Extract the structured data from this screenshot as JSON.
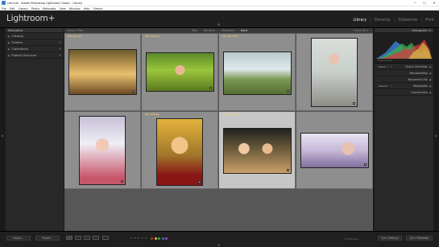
{
  "window": {
    "title": "cat.lrcat - Adobe Photoshop Lightroom Classic - Library",
    "controls": [
      "—",
      "☐",
      "✕"
    ]
  },
  "menu": [
    "File",
    "Edit",
    "Library",
    "Photo",
    "Metadata",
    "View",
    "Window",
    "Help",
    "Simple"
  ],
  "identity": {
    "logo": "Lightroom+",
    "modules": [
      {
        "label": "Library",
        "active": true
      },
      {
        "label": "Develop",
        "active": false
      },
      {
        "label": "Slideshow",
        "active": false
      },
      {
        "label": "Print",
        "active": false
      }
    ],
    "separator": "|"
  },
  "left_panel": {
    "header": "Navigator",
    "items": [
      {
        "label": "Catalog",
        "plus": ""
      },
      {
        "label": "Folders",
        "plus": "+"
      },
      {
        "label": "Collections",
        "plus": "+"
      },
      {
        "label": "Publish Services",
        "plus": "+"
      }
    ]
  },
  "filter_bar": {
    "crumb": "Library Filter :",
    "tabs": [
      {
        "label": "Text",
        "on": false
      },
      {
        "label": "Attribute",
        "on": false
      },
      {
        "label": "Metadata",
        "on": false
      },
      {
        "label": "None",
        "on": true
      }
    ],
    "preset": "Filters Off ▾"
  },
  "grid": {
    "cells": [
      {
        "index": "1",
        "filename": "IMG_2201.jpg",
        "selected": false,
        "photo": "p1",
        "orientation": "landscape"
      },
      {
        "index": "2",
        "filename": "IMG_2202.jpg",
        "selected": false,
        "photo": "p2",
        "orientation": "landscape"
      },
      {
        "index": "3",
        "filename": "DSC_0317.NEF",
        "selected": false,
        "photo": "p3",
        "orientation": "landscape"
      },
      {
        "index": "4",
        "filename": "",
        "selected": false,
        "photo": "p4",
        "orientation": "portrait"
      },
      {
        "index": "5",
        "filename": "",
        "selected": false,
        "photo": "p5",
        "orientation": "portrait"
      },
      {
        "index": "6",
        "filename": "IMG_2206.jpg",
        "selected": false,
        "photo": "p6",
        "orientation": "portrait"
      },
      {
        "index": "7",
        "filename": "IMG_2207_6.JPG",
        "selected": true,
        "photo": "p7",
        "orientation": "landscape"
      },
      {
        "index": "8",
        "filename": "",
        "selected": false,
        "photo": "p8",
        "orientation": "landscape"
      }
    ]
  },
  "right_panel": {
    "histogram_header": "Histogram",
    "histogram_meta": "Original Photo",
    "sections": [
      {
        "label": "Quick Develop",
        "select": "Saved",
        "has_select": true
      },
      {
        "label": "Keywording",
        "select": "",
        "has_select": false
      },
      {
        "label": "Keyword List",
        "select": "",
        "has_select": false
      },
      {
        "label": "Metadata",
        "select": "Default",
        "has_select": true
      },
      {
        "label": "Comments",
        "select": "",
        "has_select": false
      }
    ]
  },
  "bottom": {
    "import_label": "Import...",
    "export_label": "Export...",
    "stars": [
      "★",
      "★",
      "★",
      "★",
      "★"
    ],
    "color_labels": [
      "#c03030",
      "#d6c83a",
      "#3fa040",
      "#3a6ad0",
      "#9a4ad0"
    ],
    "sort_label": "Thumbnails",
    "sync_settings_label": "Sync Settings",
    "sync_metadata_label": "Sync Metadata"
  }
}
